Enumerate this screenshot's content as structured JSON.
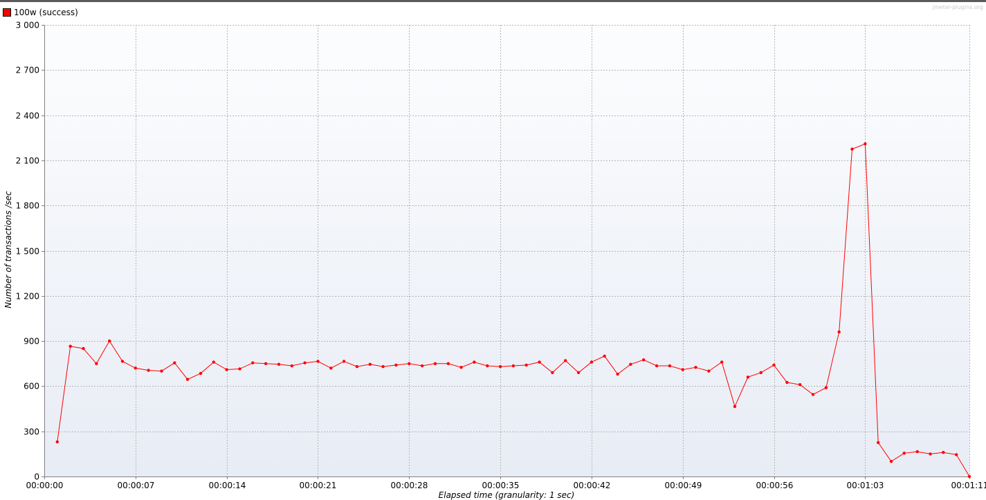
{
  "watermark": "jmeter-plugins.org",
  "legend": {
    "label": "100w (success)",
    "color": "#ff0000"
  },
  "chart_data": {
    "type": "line",
    "xlabel": "Elapsed time (granularity: 1 sec)",
    "ylabel": "Number of transactions /sec",
    "xlim": [
      0,
      71
    ],
    "ylim": [
      0,
      3000
    ],
    "x_ticks": [
      0,
      7,
      14,
      21,
      28,
      35,
      42,
      49,
      56,
      63,
      71
    ],
    "x_tick_labels": [
      "00:00:00",
      "00:00:07",
      "00:00:14",
      "00:00:21",
      "00:00:28",
      "00:00:35",
      "00:00:42",
      "00:00:49",
      "00:00:56",
      "00:01:03",
      "00:01:11"
    ],
    "y_ticks": [
      0,
      300,
      600,
      900,
      1200,
      1500,
      1800,
      2100,
      2400,
      2700,
      3000
    ],
    "y_tick_labels": [
      "0",
      "300",
      "600",
      "900",
      "1 200",
      "1 500",
      "1 800",
      "2 100",
      "2 400",
      "2 700",
      "3 000"
    ],
    "grid": true,
    "legend_position": "top-left",
    "series": [
      {
        "name": "100w (success)",
        "color": "#ff0000",
        "x": [
          1,
          2,
          3,
          4,
          5,
          6,
          7,
          8,
          9,
          10,
          11,
          12,
          13,
          14,
          15,
          16,
          17,
          18,
          19,
          20,
          21,
          22,
          23,
          24,
          25,
          26,
          27,
          28,
          29,
          30,
          31,
          32,
          33,
          34,
          35,
          36,
          37,
          38,
          39,
          40,
          41,
          42,
          43,
          44,
          45,
          46,
          47,
          48,
          49,
          50,
          51,
          52,
          53,
          54,
          55,
          56,
          57,
          58,
          59,
          60,
          61,
          62,
          63,
          64,
          65,
          66,
          67,
          68,
          69,
          70,
          71
        ],
        "y": [
          230,
          865,
          850,
          750,
          900,
          765,
          720,
          705,
          700,
          755,
          645,
          685,
          760,
          710,
          715,
          755,
          750,
          745,
          735,
          755,
          765,
          720,
          765,
          730,
          745,
          730,
          740,
          750,
          735,
          750,
          750,
          725,
          760,
          735,
          730,
          735,
          740,
          760,
          690,
          770,
          690,
          760,
          800,
          680,
          745,
          775,
          735,
          735,
          710,
          725,
          700,
          760,
          465,
          660,
          690,
          740,
          625,
          610,
          545,
          590,
          960,
          2175,
          2210,
          225,
          100,
          155,
          165,
          150,
          160,
          145,
          0
        ]
      }
    ]
  }
}
